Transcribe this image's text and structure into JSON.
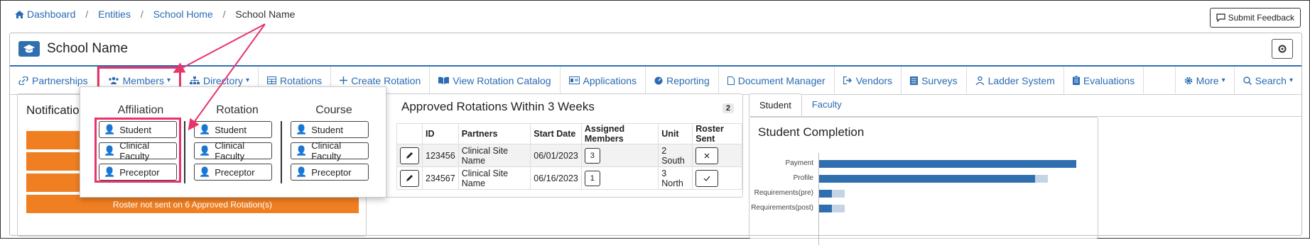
{
  "breadcrumb": {
    "dashboard": "Dashboard",
    "entities": "Entities",
    "school_home": "School Home",
    "current": "School Name"
  },
  "feedback_label": "Submit Feedback",
  "page_title": "School Name",
  "nav": {
    "partnerships": "Partnerships",
    "members": "Members",
    "directory": "Directory",
    "rotations": "Rotations",
    "create_rotation": "Create Rotation",
    "view_catalog": "View Rotation Catalog",
    "applications": "Applications",
    "reporting": "Reporting",
    "document_manager": "Document Manager",
    "vendors": "Vendors",
    "surveys": "Surveys",
    "ladder_system": "Ladder System",
    "evaluations": "Evaluations",
    "more": "More",
    "search": "Search"
  },
  "notifications": {
    "title": "Notification",
    "last_bar": "Roster not sent on 6 Approved Rotation(s)"
  },
  "dropdown": {
    "columns": [
      {
        "heading": "Affiliation",
        "student": "Student",
        "faculty": "Clinical Faculty",
        "preceptor": "Preceptor"
      },
      {
        "heading": "Rotation",
        "student": "Student",
        "faculty": "Clinical Faculty",
        "preceptor": "Preceptor"
      },
      {
        "heading": "Course",
        "student": "Student",
        "faculty": "Clinical Faculty",
        "preceptor": "Preceptor"
      }
    ]
  },
  "rotations": {
    "title": "Approved Rotations Within 3 Weeks",
    "count": "2",
    "headers": {
      "id": "ID",
      "partners": "Partners",
      "start": "Start Date",
      "assigned": "Assigned Members",
      "unit": "Unit",
      "roster": "Roster Sent"
    },
    "rows": [
      {
        "id": "123456",
        "partner": "Clinical Site Name",
        "start": "06/01/2023",
        "assigned": "3",
        "unit": "2 South",
        "roster_sent": false
      },
      {
        "id": "234567",
        "partner": "Clinical Site Name",
        "start": "06/16/2023",
        "assigned": "1",
        "unit": "3 North",
        "roster_sent": true
      }
    ]
  },
  "tabs": {
    "student": "Student",
    "faculty": "Faculty"
  },
  "completion": {
    "title": "Student Completion"
  },
  "chart_data": {
    "type": "bar",
    "orientation": "horizontal",
    "categories": [
      "Payment",
      "Profile",
      "Requirements(pre)",
      "Requirements(post)"
    ],
    "series": [
      {
        "values": [
          100,
          84,
          5,
          5
        ]
      },
      {
        "values": [
          0,
          5,
          5,
          5
        ]
      }
    ],
    "xlim": [
      0,
      100
    ],
    "colors": [
      "#2f6fb0",
      "#c3d4e6"
    ]
  },
  "colors": {
    "accent": "#2f6fb0",
    "highlight": "#e8336b",
    "warning": "#f07f22"
  }
}
